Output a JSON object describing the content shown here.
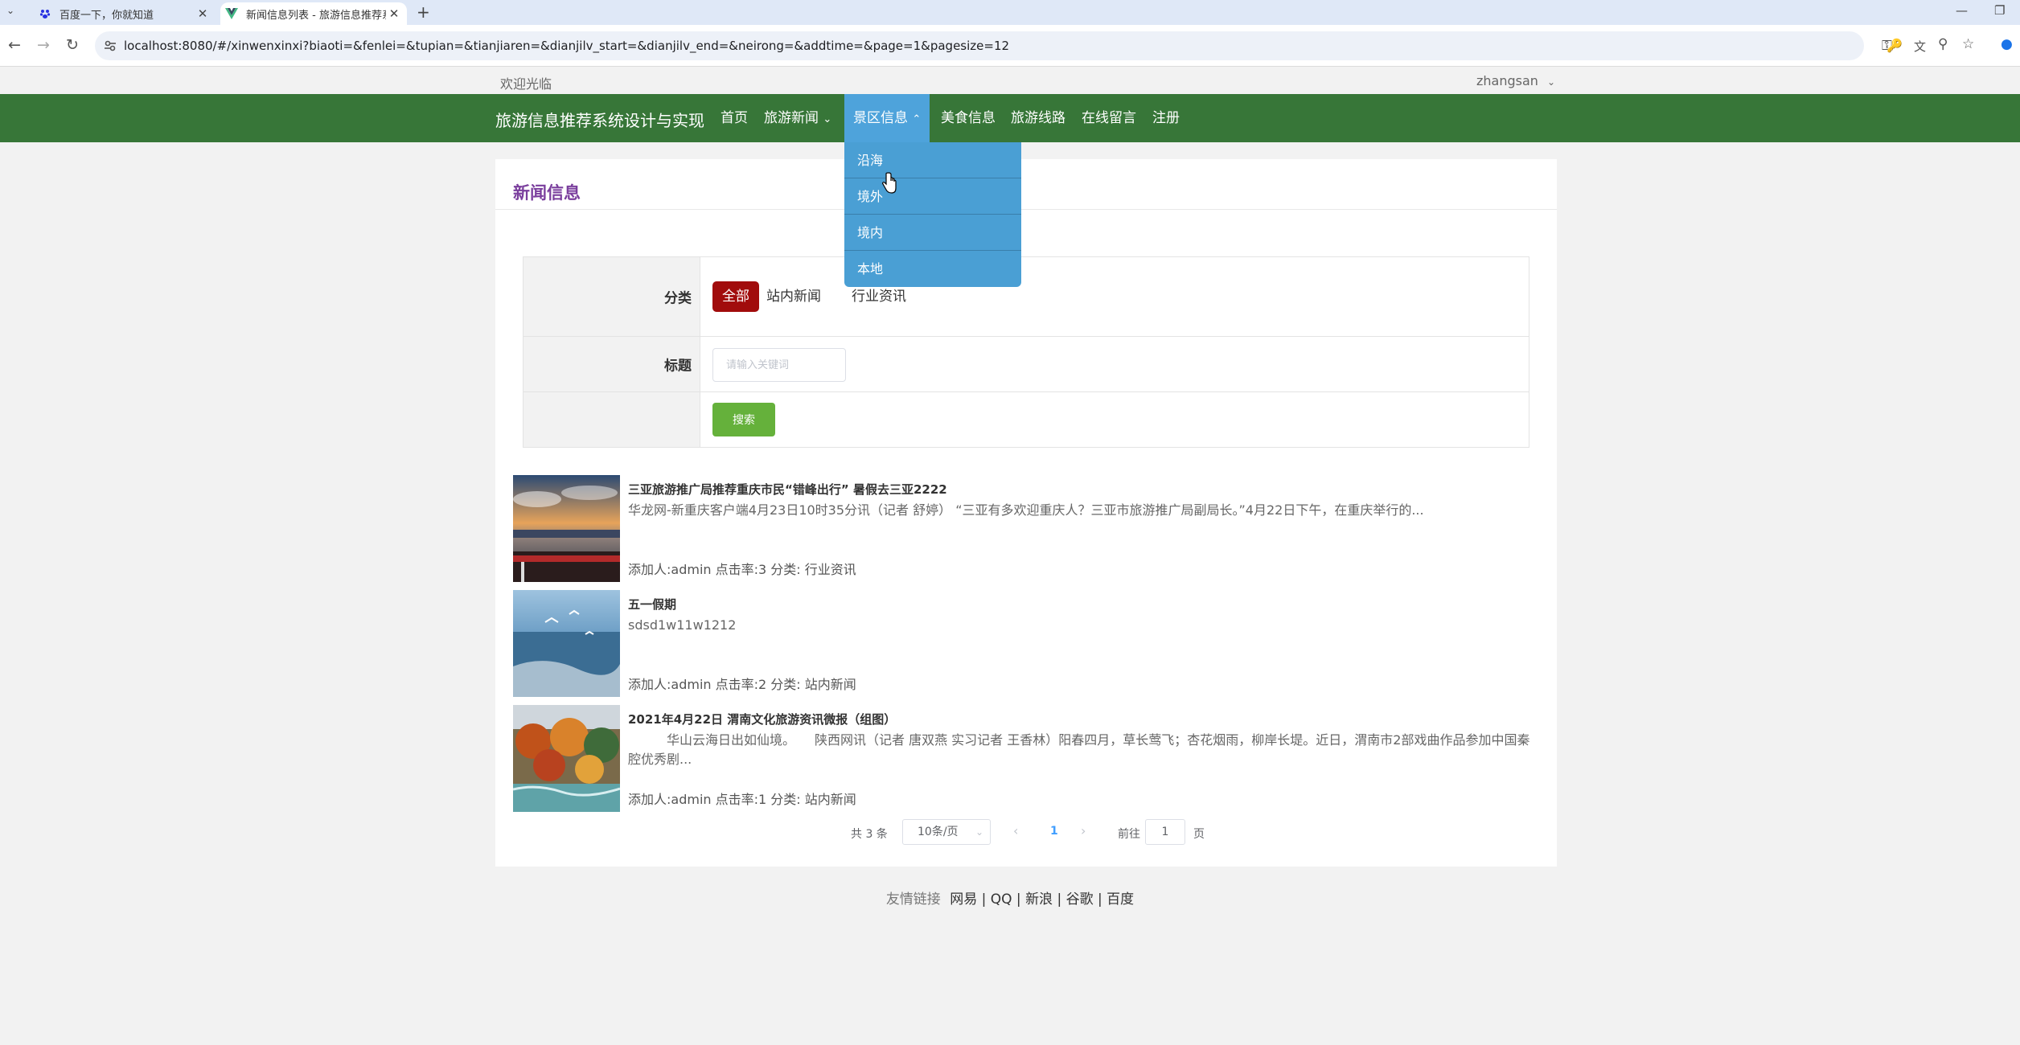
{
  "browser": {
    "tabs": [
      {
        "title": "百度一下，你就知道",
        "active": false
      },
      {
        "title": "新闻信息列表 - 旅游信息推荐系",
        "active": true
      }
    ],
    "url": "localhost:8080/#/xinwenxinxi?biaoti=&fenlei=&tupian=&tianjiaren=&dianjilv_start=&dianjilv_end=&neirong=&addtime=&page=1&pagesize=12"
  },
  "site": {
    "welcome": "欢迎光临",
    "username": "zhangsan",
    "brand": "旅游信息推荐系统设计与实现",
    "nav": [
      {
        "label": "首页",
        "dropdown": false
      },
      {
        "label": "旅游新闻",
        "dropdown": true
      },
      {
        "label": "景区信息",
        "dropdown": true,
        "active": true
      },
      {
        "label": "美食信息",
        "dropdown": false
      },
      {
        "label": "旅游线路",
        "dropdown": false
      },
      {
        "label": "在线留言",
        "dropdown": false
      },
      {
        "label": "注册",
        "dropdown": false
      }
    ],
    "scenic_dropdown": [
      "沿海",
      "境外",
      "境内",
      "本地"
    ]
  },
  "panel": {
    "title": "新闻信息",
    "filter": {
      "category_label": "分类",
      "categories": [
        {
          "label": "全部",
          "selected": true
        },
        {
          "label": "站内新闻",
          "selected": false
        },
        {
          "label": "行业资讯",
          "selected": false
        }
      ],
      "title_label": "标题",
      "keyword_placeholder": "请输入关键词",
      "search_button": "搜索"
    },
    "news": [
      {
        "title": "三亚旅游推广局推荐重庆市民“错峰出行” 暑假去三亚2222",
        "summary": "华龙网-新重庆客户端4月23日10时35分讯（记者 舒婷） “三亚有多欢迎重庆人？三亚市旅游推广局副局长。”4月22日下午，在重庆举行的...",
        "meta": "添加人:admin  点击率:3  分类: 行业资讯"
      },
      {
        "title": "五一假期",
        "summary": "sdsd1w11w1212",
        "meta": "添加人:admin  点击率:2  分类: 站内新闻"
      },
      {
        "title": "2021年4月22日 渭南文化旅游资讯微报（组图）",
        "summary": "　　　华山云海日出如仙境。　　陕西网讯（记者 唐双燕 实习记者 王香林）阳春四月，草长莺飞；杏花烟雨，柳岸长堤。近日，渭南市2部戏曲作品参加中国秦腔优秀剧...",
        "meta": "添加人:admin  点击率:1  分类: 站内新闻"
      }
    ],
    "pagination": {
      "total": "共 3 条",
      "page_size": "10条/页",
      "current": "1",
      "goto_label": "前往",
      "goto_value": "1",
      "page_unit": "页"
    }
  },
  "footer": {
    "label": "友情链接",
    "links": [
      "网易",
      "QQ",
      "新浪",
      "谷歌",
      "百度"
    ]
  }
}
